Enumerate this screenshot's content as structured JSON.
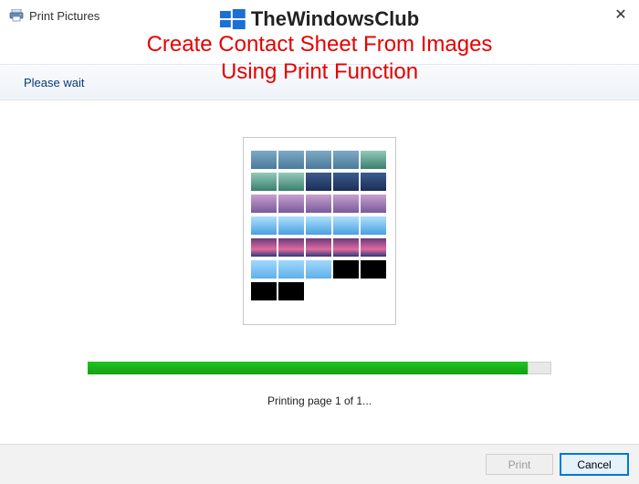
{
  "window": {
    "title": "Print Pictures",
    "close_glyph": "✕"
  },
  "brand": {
    "name": "TheWindowsClub"
  },
  "headline": {
    "line1": "Create Contact Sheet From Images",
    "line2": "Using Print Function"
  },
  "please_wait": "Please wait",
  "status": "Printing page 1 of 1...",
  "buttons": {
    "print": "Print",
    "cancel": "Cancel"
  },
  "progress": {
    "percent": 95
  }
}
